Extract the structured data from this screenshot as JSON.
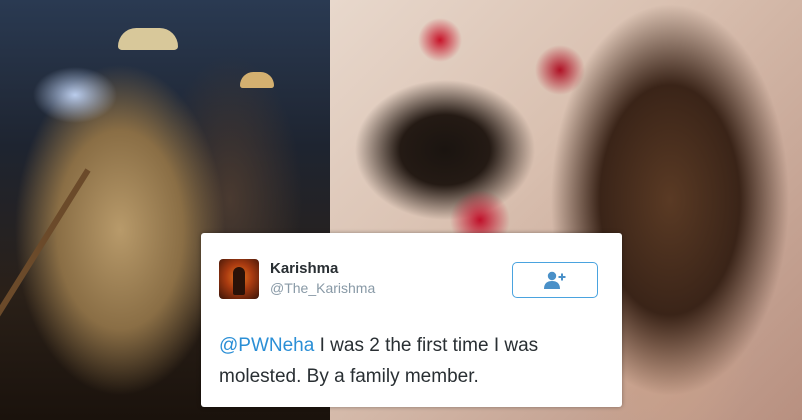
{
  "tweet": {
    "name": "Karishma",
    "handle": "@The_Karishma",
    "mention": "@PWNeha",
    "text_line1": " I was 2 the first time I was",
    "text_line2": "molested. By a family member.",
    "follow_icon": "add-user-icon"
  },
  "colors": {
    "mention": "#2b8fd6",
    "follow_border": "#4aa3df",
    "follow_icon": "#4a90c8",
    "name": "#292f33",
    "handle": "#8899a6"
  }
}
